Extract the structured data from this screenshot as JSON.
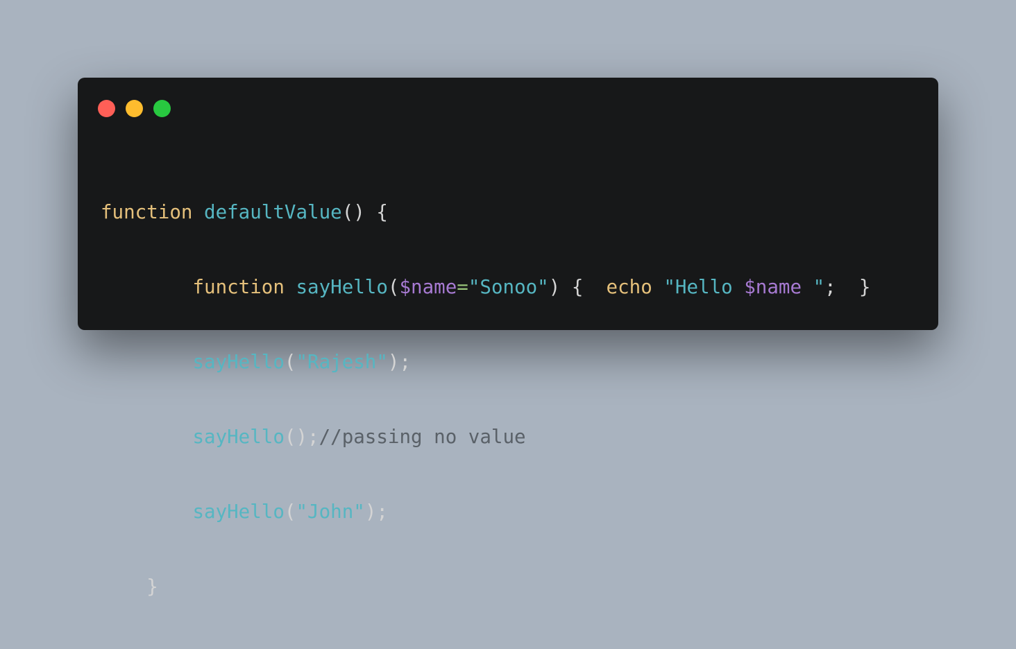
{
  "window": {
    "controls": [
      "close",
      "minimize",
      "maximize"
    ],
    "colors": {
      "close": "#ff5f57",
      "minimize": "#febc2e",
      "maximize": "#28c840",
      "background": "#171819"
    }
  },
  "code": {
    "l1": {
      "kw": "function",
      "fn": "defaultValue",
      "rest": "() {"
    },
    "l2": {
      "indent": "        ",
      "kw": "function",
      "fn": "sayHello",
      "p1": "(",
      "var": "$name",
      "eq": "=",
      "str": "\"Sonoo\"",
      "p2": ") {  ",
      "echo": "echo",
      "str2a": "\"Hello ",
      "var2": "$name",
      "str2b": " \"",
      "p3": ";  }"
    },
    "l3": {
      "indent": "        ",
      "fn": "sayHello",
      "p1": "(",
      "str": "\"Rajesh\"",
      "p2": ");"
    },
    "l4": {
      "indent": "        ",
      "fn": "sayHello",
      "p1": "();",
      "cmt": "//passing no value"
    },
    "l5": {
      "indent": "        ",
      "fn": "sayHello",
      "p1": "(",
      "str": "\"John\"",
      "p2": ");"
    },
    "l6": {
      "indent": "    ",
      "brace": "}"
    }
  }
}
